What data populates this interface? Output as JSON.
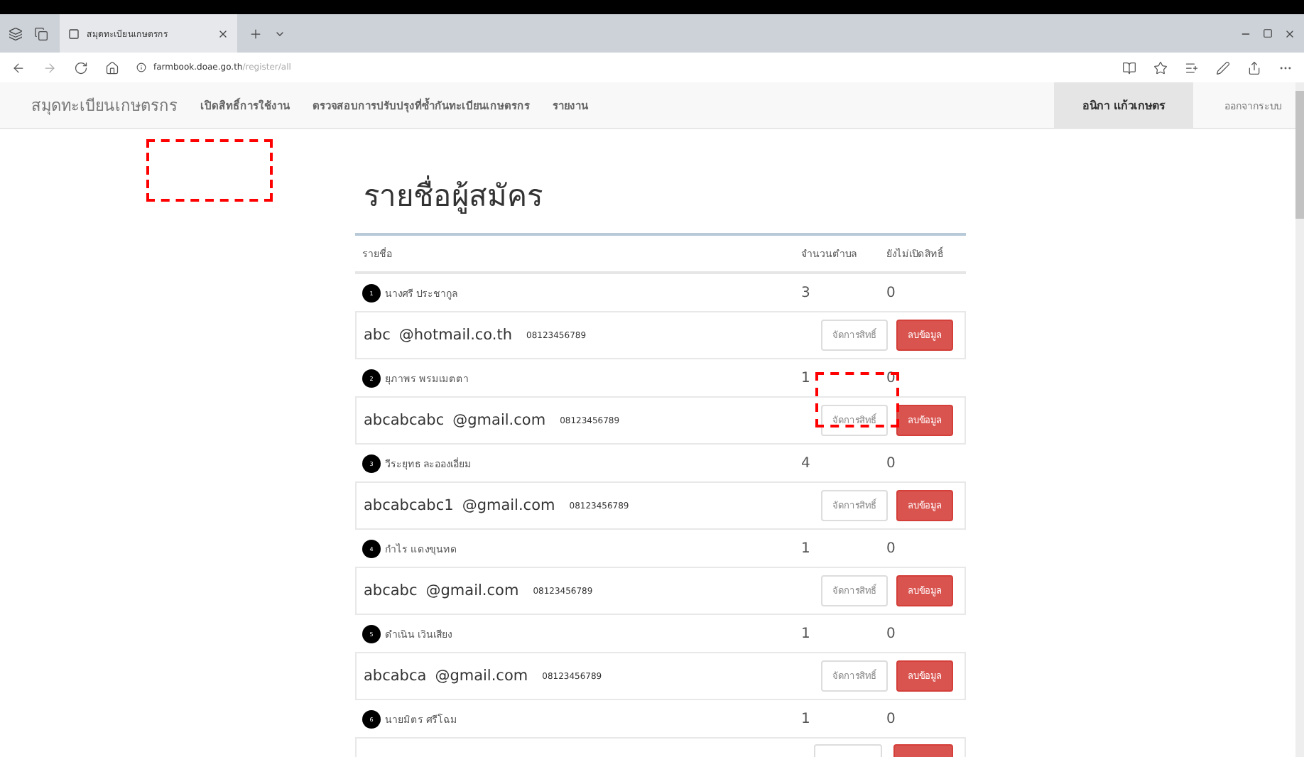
{
  "browser": {
    "tab_title": "สมุดทะเบียนเกษตรกร",
    "url_host": "farmbook.doae.go.th",
    "url_path": "/register/all"
  },
  "navbar": {
    "brand": "สมุดทะเบียนเกษตรกร",
    "links": [
      "เปิดสิทธิ์การใช้งาน",
      "ตรวจสอบการปรับปรุงที่ซ้ำกันทะเบียนเกษตรกร",
      "รายงาน"
    ],
    "user": "อนิกา แก้วเกษตร",
    "logout": "ออกจากระบบ"
  },
  "page": {
    "title": "รายชื่อผู้สมัคร"
  },
  "table": {
    "columns": [
      "รายชื่อ",
      "จำนวนตำบล",
      "ยังไม่เปิดสิทธิ์"
    ],
    "rows": [
      {
        "number": "1",
        "name": "นางศรี ประชากูล",
        "count": "3",
        "unopened": "0",
        "user": "abc",
        "domain": "@hotmail.co.th",
        "phone": "08123456789",
        "manage": "จัดการสิทธิ์",
        "delete": "ลบข้อมูล"
      },
      {
        "number": "2",
        "name": "ยุภาพร พรมเมตตา",
        "count": "1",
        "unopened": "0",
        "user": "abcabcabc",
        "domain": "@gmail.com",
        "phone": "08123456789",
        "manage": "จัดการสิทธิ์",
        "delete": "ลบข้อมูล"
      },
      {
        "number": "3",
        "name": "วีระยุทธ ละอองเอี่ยม",
        "count": "4",
        "unopened": "0",
        "user": "abcabcabc1",
        "domain": "@gmail.com",
        "phone": "08123456789",
        "manage": "จัดการสิทธิ์",
        "delete": "ลบข้อมูล"
      },
      {
        "number": "4",
        "name": "กำไร แดงขุนทด",
        "count": "1",
        "unopened": "0",
        "user": "abcabc",
        "domain": "@gmail.com",
        "phone": "08123456789",
        "manage": "จัดการสิทธิ์",
        "delete": "ลบข้อมูล"
      },
      {
        "number": "5",
        "name": "ดำเนิน เวินเสียง",
        "count": "1",
        "unopened": "0",
        "user": "abcabca",
        "domain": "@gmail.com",
        "phone": "08123456789",
        "manage": "จัดการสิทธิ์",
        "delete": "ลบข้อมูล"
      },
      {
        "number": "6",
        "name": "นายมิตร ศรีโฉม",
        "count": "1",
        "unopened": "0"
      }
    ]
  }
}
